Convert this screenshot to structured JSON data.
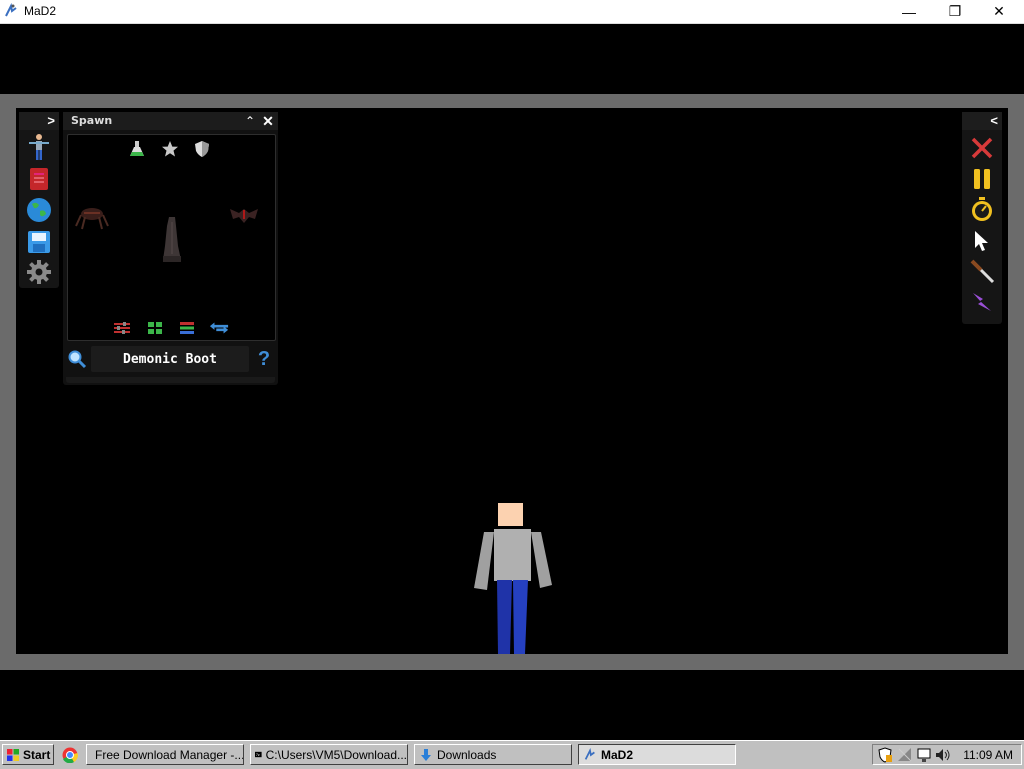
{
  "window": {
    "title": "MaD2",
    "minimize_glyph": "—",
    "restore_glyph": "❐",
    "close_glyph": "✕"
  },
  "left_toolbar": {
    "toggle_glyph": ">",
    "tools": [
      "human-icon",
      "book-icon",
      "globe-icon",
      "floppy-disk-icon",
      "gear-icon"
    ]
  },
  "spawn_panel": {
    "title": "Spawn",
    "collapse_glyph": "⌃",
    "close_glyph": "✕",
    "categories": [
      "potion-icon",
      "star-icon",
      "shield-icon"
    ],
    "items": [
      "demonic-spider",
      "demonic-boot",
      "demonic-bat"
    ],
    "view_buttons": [
      "sliders-icon",
      "grid-icon",
      "list-icon",
      "swap-arrows-icon"
    ],
    "selected_item": "Demonic Boot",
    "help_glyph": "?"
  },
  "right_toolbar": {
    "toggle_glyph": "<",
    "tools": [
      "delete-icon",
      "pause-icon",
      "stopwatch-icon",
      "cursor-icon",
      "knife-icon",
      "lightning-icon"
    ]
  },
  "taskbar": {
    "start_label": "Start",
    "tasks": [
      {
        "label": "Free Download Manager -..."
      },
      {
        "label": "C:\\Users\\VM5\\Download..."
      },
      {
        "label": "Downloads"
      },
      {
        "label": "MaD2"
      }
    ],
    "clock": "11:09 AM"
  },
  "colors": {
    "frame": "#6b6b6b",
    "accent_blue": "#3f8ed8",
    "delete_red": "#d83a3a",
    "pause_yellow": "#f0c020",
    "lightning_purple": "#9b4fd8"
  }
}
